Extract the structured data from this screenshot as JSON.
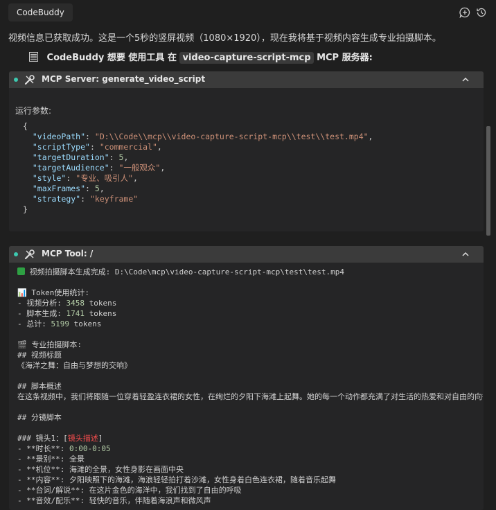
{
  "app": {
    "tab_label": "CodeBuddy"
  },
  "intro_text": "视频信息已获取成功。这是一个5秒的竖屏视频（1080×1920），现在我将基于视频内容生成专业拍摄脚本。",
  "request": {
    "prefix": "CodeBuddy 想要 使用工具 在",
    "server_name": "video-capture-script-mcp",
    "suffix": "MCP 服务器:"
  },
  "panel1": {
    "title": "MCP Server: generate_video_script",
    "params_label": "运行参数:",
    "params": {
      "videoPath": "\"D:\\\\Code\\\\mcp\\\\video-capture-script-mcp\\\\test\\\\test.mp4\"",
      "scriptType": "\"commercial\"",
      "targetDuration": "5",
      "targetAudience": "\"一般观众\"",
      "style": "\"专业、吸引人\"",
      "maxFrames": "5",
      "strategy": "\"keyframe\""
    }
  },
  "panel2": {
    "title": "MCP Tool: /",
    "result_line": " 视频拍摄脚本生成完成: D:\\Code\\mcp\\video-capture-script-mcp\\test\\test.mp4",
    "token_header": "📊 Token使用统计:",
    "token_rows": [
      {
        "label": "- 视频分析: ",
        "value": "3458",
        "unit": " tokens"
      },
      {
        "label": "- 脚本生成: ",
        "value": "1741",
        "unit": " tokens"
      },
      {
        "label": "- 总计: ",
        "value": "5199",
        "unit": " tokens"
      }
    ],
    "script_header": "🎬 专业拍摄脚本:",
    "video_title_h": "## 视频标题",
    "video_title": "《海洋之舞：自由与梦想的交响》",
    "overview_h": "## 脚本概述",
    "overview": "在这条视频中，我们将跟随一位穿着轻盈连衣裙的女性，在绚烂的夕阳下海滩上起舞。她的每一个动作都充满了对生活的热爱和对自由的向往。",
    "storyboard_h": "## 分镜脚本",
    "shot1_prefix": "### 镜头1：[",
    "shot1_desc": "镜头描述",
    "shot1_suffix": "]",
    "duration_label": "- **时长**: ",
    "duration_value": "0:00-0:05",
    "lines": [
      "- **景别**: 全景",
      "- **机位**: 海滩的全景，女性身影在画面中央",
      "- **内容**: 夕阳映照下的海滩，海浪轻轻拍打着沙滩，女性身着白色连衣裙，随着音乐起舞",
      "- **台词/解说**: 在这片金色的海洋中，我们找到了自由的呼吸",
      "- **音效/配乐**: 轻快的音乐，伴随着海浪声和微风声"
    ]
  }
}
